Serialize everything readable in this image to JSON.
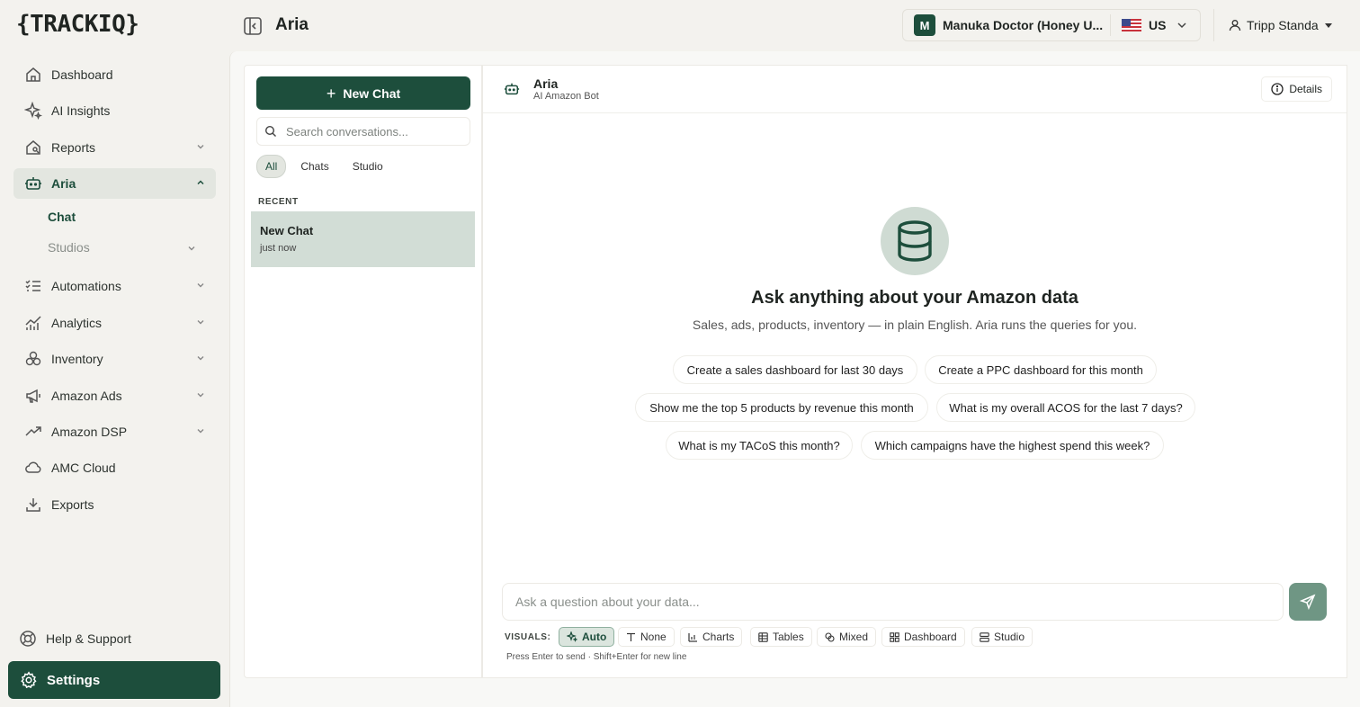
{
  "brand": {
    "logo": "{TRACKIQ}"
  },
  "header": {
    "title": "Aria",
    "store_initial": "M",
    "store_name": "Manuka Doctor (Honey U...",
    "country": "US",
    "user_name": "Tripp Standa"
  },
  "sidebar": {
    "items": [
      {
        "label": "Dashboard"
      },
      {
        "label": "AI Insights"
      },
      {
        "label": "Reports"
      },
      {
        "label": "Aria"
      },
      {
        "label": "Automations"
      },
      {
        "label": "Analytics"
      },
      {
        "label": "Inventory"
      },
      {
        "label": "Amazon Ads"
      },
      {
        "label": "Amazon DSP"
      },
      {
        "label": "AMC Cloud"
      },
      {
        "label": "Exports"
      }
    ],
    "sub_items": [
      {
        "label": "Chat"
      },
      {
        "label": "Studios"
      }
    ],
    "help": "Help & Support",
    "settings": "Settings"
  },
  "chat_list": {
    "new_chat": "New Chat",
    "search_placeholder": "Search conversations...",
    "filters": [
      "All",
      "Chats",
      "Studio"
    ],
    "recent_label": "RECENT",
    "conversations": [
      {
        "title": "New Chat",
        "time": "just now"
      }
    ]
  },
  "chat": {
    "bot_name": "Aria",
    "bot_subtitle": "AI Amazon Bot",
    "details": "Details",
    "hero_title": "Ask anything about your Amazon data",
    "hero_subtitle": "Sales, ads, products, inventory — in plain English. Aria runs the queries for you.",
    "suggestions": [
      "Create a sales dashboard for last 30 days",
      "Create a PPC dashboard for this month",
      "Show me the top 5 products by revenue this month",
      "What is my overall ACOS for the last 7 days?",
      "What is my TACoS this month?",
      "Which campaigns have the highest spend this week?"
    ],
    "input_placeholder": "Ask a question about your data...",
    "visuals_label": "VISUALS:",
    "visuals": [
      "Auto",
      "None",
      "Charts",
      "Tables",
      "Mixed",
      "Dashboard",
      "Studio"
    ],
    "hint": "Press Enter to send · Shift+Enter for new line"
  },
  "colors": {
    "brand": "#1d4e3c",
    "active_bg": "#e3e6e0",
    "selected_row": "#d2ddd6",
    "send": "#6f9684"
  }
}
